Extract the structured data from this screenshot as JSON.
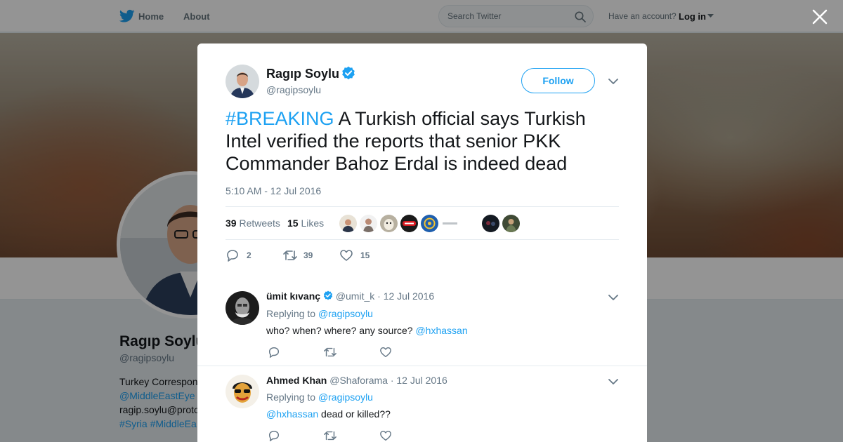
{
  "topbar": {
    "home": "Home",
    "about": "About",
    "search_placeholder": "Search Twitter",
    "have_account": "Have an account?",
    "login": "Log in"
  },
  "background_profile": {
    "name": "Ragıp Soylu",
    "handle": "@ragipsoylu",
    "bio_line1": "Turkey Correspon",
    "bio_line2": "@MiddleEastEye",
    "bio_line3": "ragip.soylu@proto",
    "bio_line4": "#Syria #MiddleEa"
  },
  "tweet": {
    "author_name": "Ragıp Soylu",
    "author_handle": "@ragipsoylu",
    "follow_label": "Follow",
    "hashtag": "#BREAKING",
    "text": " A Turkish official says Turkish Intel verified the reports that senior PKK Commander Bahoz Erdal is indeed dead",
    "timestamp": "5:10 AM - 12 Jul 2016",
    "retweets_count": "39",
    "retweets_label": "Retweets",
    "likes_count": "15",
    "likes_label": "Likes",
    "actions": {
      "replies": "2",
      "retweets": "39",
      "likes": "15"
    }
  },
  "replies": [
    {
      "name": "ümit kıvanç",
      "handle": "@umit_k",
      "date": "12 Jul 2016",
      "replying_to_label": "Replying to",
      "replying_to": "@ragipsoylu",
      "text": "who? when? where? any source? ",
      "mention": "@hxhassan"
    },
    {
      "name": "Ahmed Khan",
      "handle": "@Shaforama",
      "date": "12 Jul 2016",
      "replying_to_label": "Replying to",
      "replying_to": "@ragipsoylu",
      "mention": "@hxhassan",
      "text": " dead or killed??"
    }
  ],
  "colors": {
    "accent": "#1da1f2",
    "text": "#14171a",
    "muted": "#657786",
    "border": "#e6ecf0"
  }
}
